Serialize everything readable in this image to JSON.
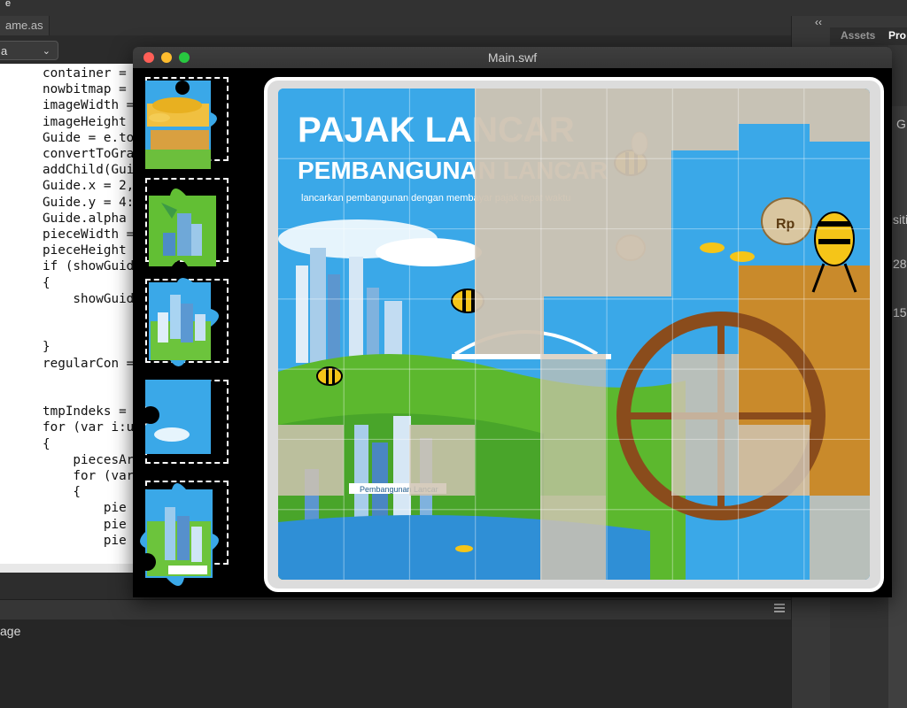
{
  "ide": {
    "top_tab": "ame.as",
    "top_tab_small": "e",
    "dropdown_value": "a",
    "code_lines": [
      {
        "t": "container = "
      },
      {
        "t": "nowbitmap = "
      },
      {
        "t": "imageWidth ="
      },
      {
        "t": "imageHeight"
      },
      {
        "t": "Guide = e.to"
      },
      {
        "t": "convertToGra"
      },
      {
        "t": "addChild(Gui"
      },
      {
        "t": "Guide.x = 2,"
      },
      {
        "t": "Guide.y = 4:"
      },
      {
        "t": "Guide.alpha "
      },
      {
        "t": "pieceWidth ="
      },
      {
        "t": "pieceHeight "
      },
      {
        "t": "if (showGuid"
      },
      {
        "t": "{"
      },
      {
        "t": "    showGuid"
      },
      {
        "t": ""
      },
      {
        "t": ""
      },
      {
        "t": "}"
      },
      {
        "t": "regularCon ="
      },
      {
        "t": ""
      },
      {
        "t": ""
      },
      {
        "t": "tmpIndeks ="
      },
      {
        "t": "for (var i:u"
      },
      {
        "t": "{"
      },
      {
        "t": "    piecesAr"
      },
      {
        "t": "    for (var"
      },
      {
        "t": "    {"
      },
      {
        "t": "        pie"
      },
      {
        "t": "        pie"
      },
      {
        "t": "        pie"
      }
    ],
    "output_label": "age",
    "right_panel": {
      "collapse": "‹‹",
      "tab_assets": "Assets",
      "tab_properties": "Pro",
      "value_1": "G",
      "value_2": "siti",
      "value_3": "28",
      "value_4": "15"
    }
  },
  "flash_window": {
    "title": "Main.swf",
    "traffic_lights": {
      "close": "#ff5f57",
      "minimize": "#febc2e",
      "zoom": "#28c840"
    }
  },
  "puzzle": {
    "headline_1": "PAJAK LANCAR",
    "headline_2": "PEMBANGUNAN LANCAR",
    "tagline": "lancarkan pembangunan dengan membayar pajak tepat waktu",
    "sign_text": "Pembangunan Lancar",
    "money_bag_label": "Rp",
    "grid_cols": 9,
    "grid_rows": 7,
    "tray_slots": 5
  },
  "colors": {
    "sky": "#37a5e6",
    "grass": "#5cb82e",
    "empty_piece": "#cfc3b2",
    "wood": "#c98a2b",
    "bee_yellow": "#f5c518"
  }
}
